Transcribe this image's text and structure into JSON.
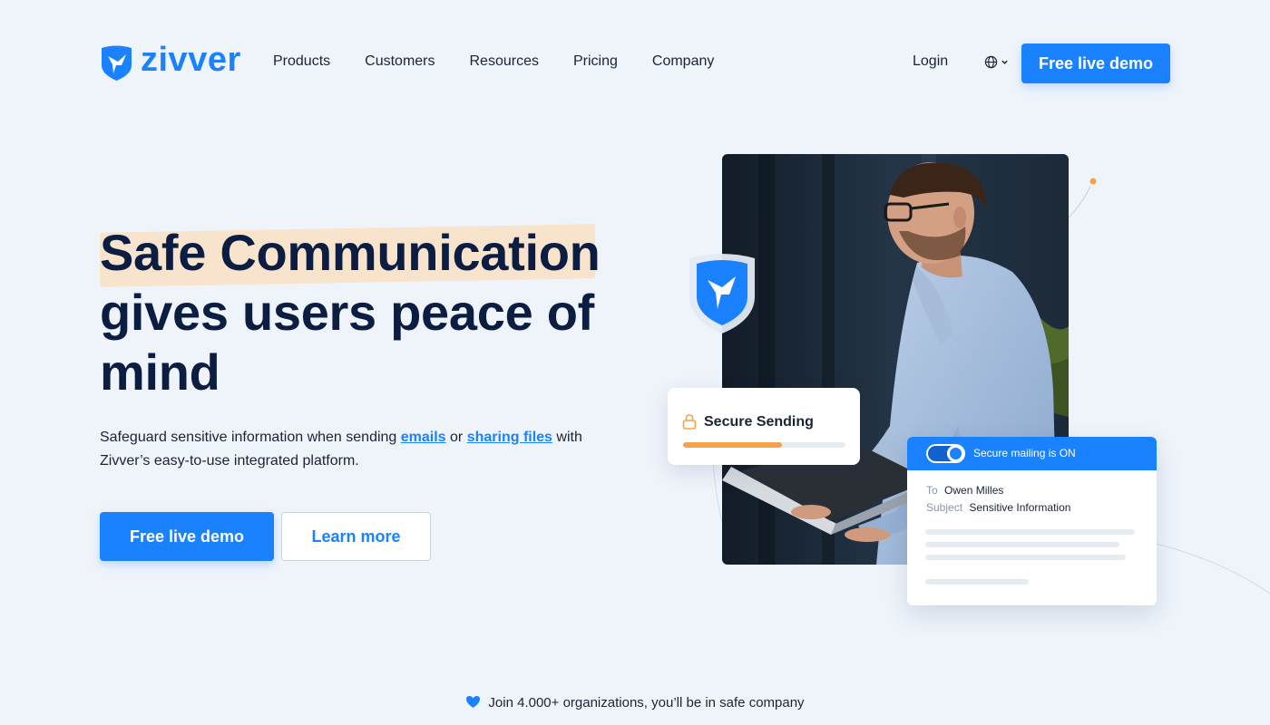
{
  "brand": {
    "name": "zivver",
    "accent": "#1a82ff",
    "highlight": "#f9e1c4",
    "progress_color": "#f5a34a"
  },
  "nav": {
    "items": [
      {
        "label": "Products"
      },
      {
        "label": "Customers"
      },
      {
        "label": "Resources"
      },
      {
        "label": "Pricing"
      },
      {
        "label": "Company"
      }
    ],
    "login": "Login",
    "language_icon": "globe-icon",
    "cta": "Free live demo"
  },
  "hero": {
    "headline_lines": [
      "Safe Communication",
      "gives users peace of",
      "mind"
    ],
    "sub_before": "Safeguard sensitive information when sending ",
    "sub_link1": "emails",
    "sub_mid": " or ",
    "sub_link2": "sharing files",
    "sub_after": " with Zivver’s easy-to-use integrated platform.",
    "primary_cta": "Free live demo",
    "secondary_cta": "Learn more"
  },
  "visual": {
    "secure_sending": {
      "title": "Secure Sending",
      "progress": 0.61
    },
    "mail_card": {
      "status": "Secure mailing is ON",
      "to_label": "To",
      "to_value": "Owen Milles",
      "subject_label": "Subject",
      "subject_value": "Sensitive Information"
    }
  },
  "footer": {
    "join_text": "Join 4.000+ organizations, you’ll be in safe company",
    "icon": "heart-icon"
  }
}
